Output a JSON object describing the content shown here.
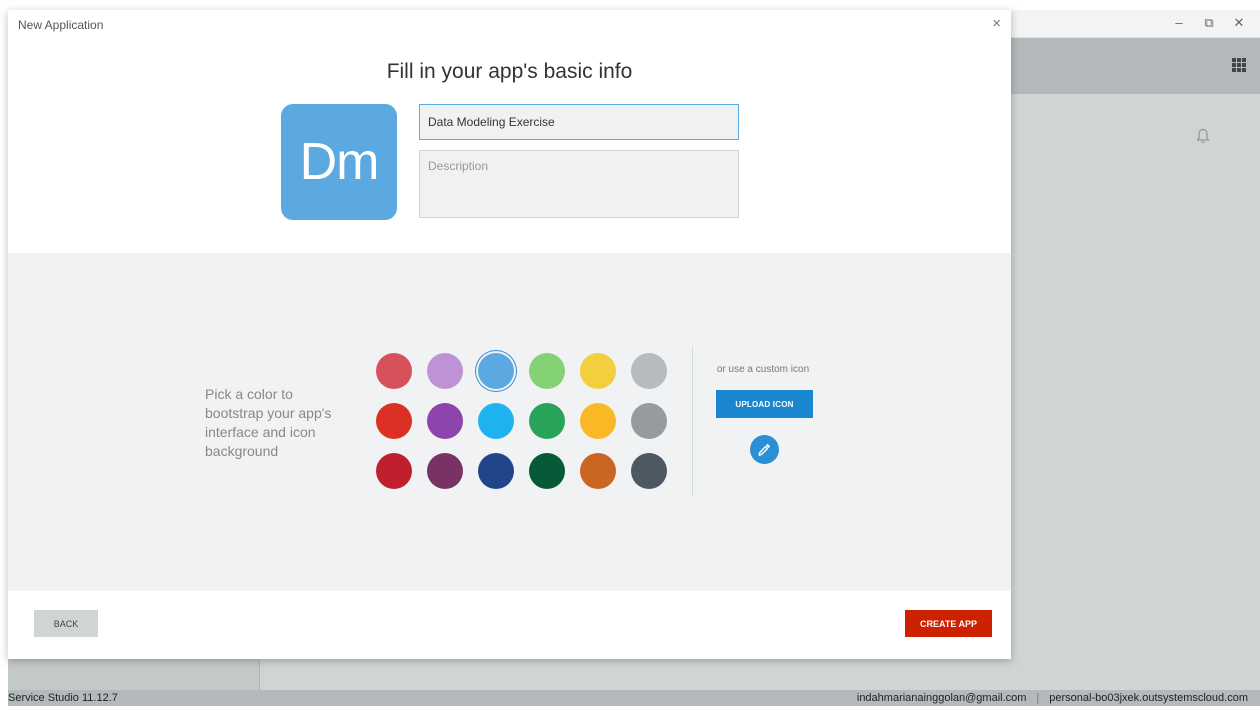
{
  "background_window": {
    "window_controls": {
      "minimize": "–",
      "restore": "⧉",
      "close": "✕"
    },
    "status_bar": {
      "version": "Service Studio 11.12.7",
      "email": "indahmarianainggolan@gmail.com",
      "separator": "|",
      "environment": "personal-bo03jxek.outsystemscloud.com"
    }
  },
  "modal": {
    "title": "New Application",
    "close_glyph": "×",
    "heading": "Fill in your app's basic info",
    "app_icon": {
      "initials": "Dm",
      "color": "#5ba9e0"
    },
    "name_field": {
      "value": "Data Modeling Exercise"
    },
    "description_field": {
      "value": "",
      "placeholder": "Description"
    },
    "color_picker": {
      "hint": "Pick a color to bootstrap your app's interface and icon background",
      "selected_index": 2,
      "colors": [
        "#d6515a",
        "#be93d6",
        "#5ba9e0",
        "#85d175",
        "#f2cf3e",
        "#b6bbbe",
        "#dd3025",
        "#8e44ad",
        "#1fb2f0",
        "#27a35a",
        "#f9b825",
        "#969b9e",
        "#c0202e",
        "#783364",
        "#22448a",
        "#065a38",
        "#ca6622",
        "#4d5862"
      ]
    },
    "custom_icon": {
      "label": "or use a custom icon",
      "upload_label": "UPLOAD ICON",
      "picker_icon": "eyedropper-icon"
    },
    "footer": {
      "back_label": "BACK",
      "create_label": "CREATE APP"
    }
  }
}
